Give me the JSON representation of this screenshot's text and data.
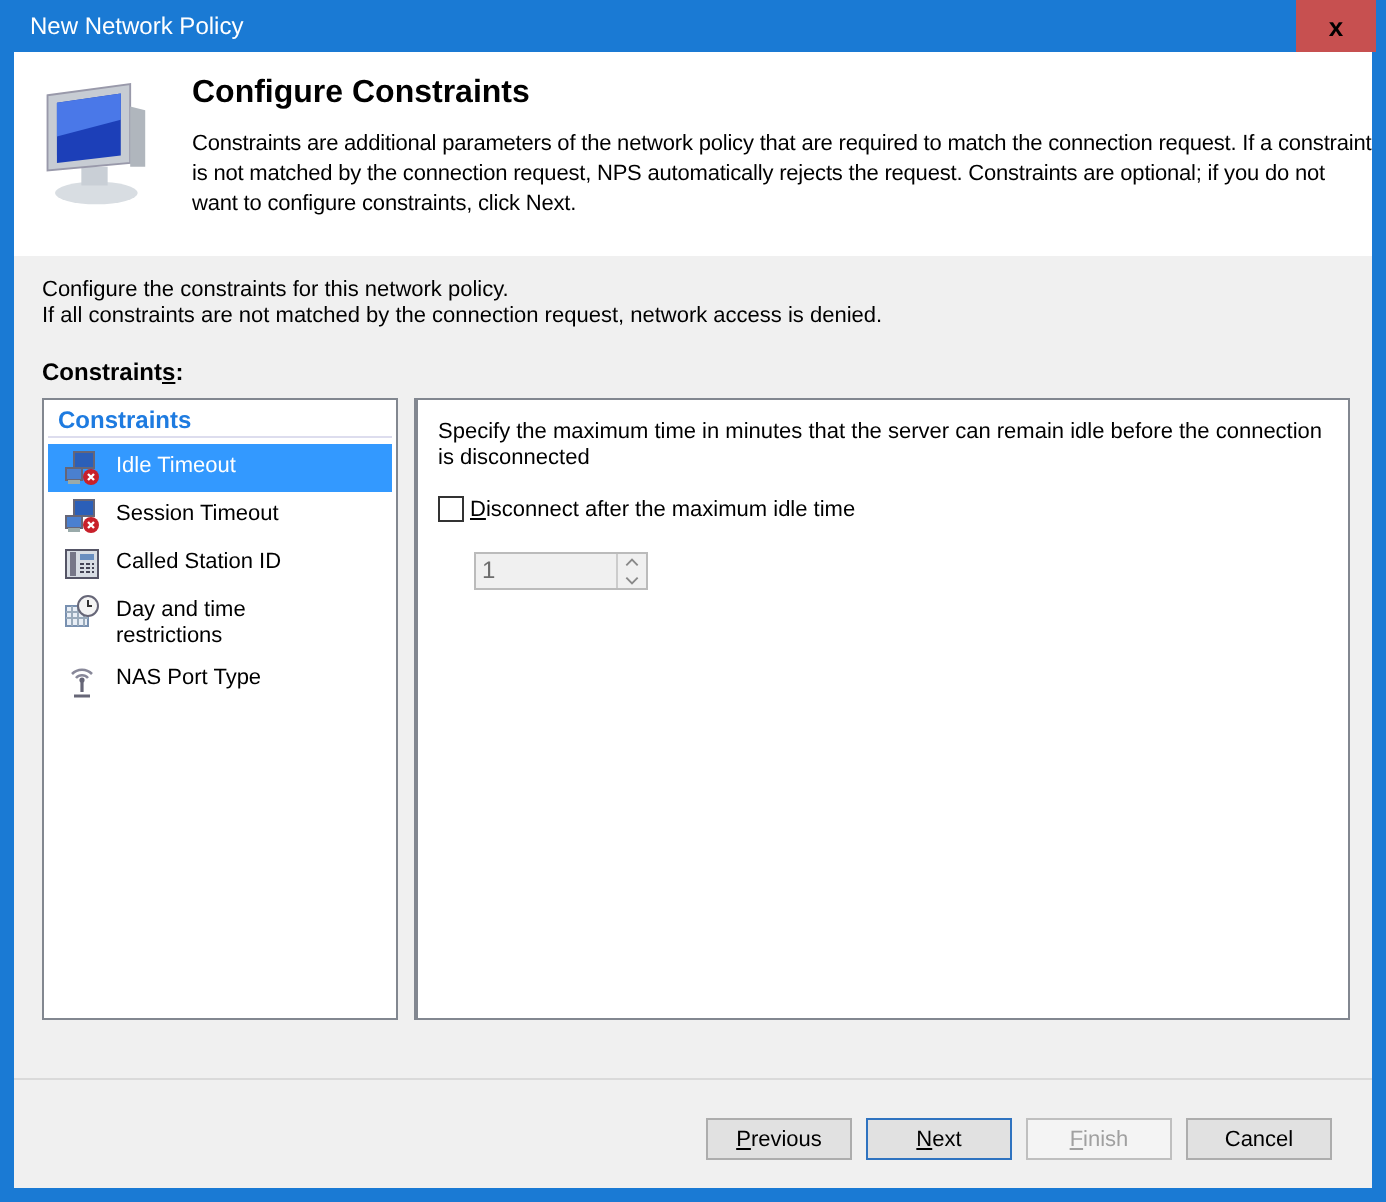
{
  "window": {
    "title": "New Network Policy",
    "close": "x"
  },
  "header": {
    "title": "Configure Constraints",
    "description": "Constraints are additional parameters of the network policy that are required to match the connection request. If a constraint is not matched by the connection request, NPS automatically rejects the request. Constraints are optional; if you do not want to configure constraints, click Next."
  },
  "intro": [
    "Configure the constraints for this network policy.",
    "If all constraints are not matched by the connection request, network access is denied."
  ],
  "constraints_label": "Constraints:",
  "sidebar": {
    "heading": "Constraints",
    "items": [
      {
        "label": "Idle Timeout",
        "kind": "timeout",
        "selected": true
      },
      {
        "label": "Session Timeout",
        "kind": "timeout",
        "selected": false
      },
      {
        "label": "Called Station ID",
        "kind": "station",
        "selected": false
      },
      {
        "label": "Day and time restrictions",
        "kind": "schedule",
        "selected": false
      },
      {
        "label": "NAS Port Type",
        "kind": "port",
        "selected": false
      }
    ]
  },
  "panel": {
    "description": "Specify the maximum time in minutes that the server can remain idle before the connection is disconnected",
    "checkbox": {
      "label": "Disconnect after the maximum idle time",
      "checked": false
    },
    "spinner": {
      "value": "1",
      "disabled": true
    }
  },
  "buttons": [
    {
      "label": "Previous",
      "disabled": false,
      "default": false
    },
    {
      "label": "Next",
      "disabled": false,
      "default": true
    },
    {
      "label": "Finish",
      "disabled": true,
      "default": false
    },
    {
      "label": "Cancel",
      "disabled": false,
      "default": false
    }
  ]
}
